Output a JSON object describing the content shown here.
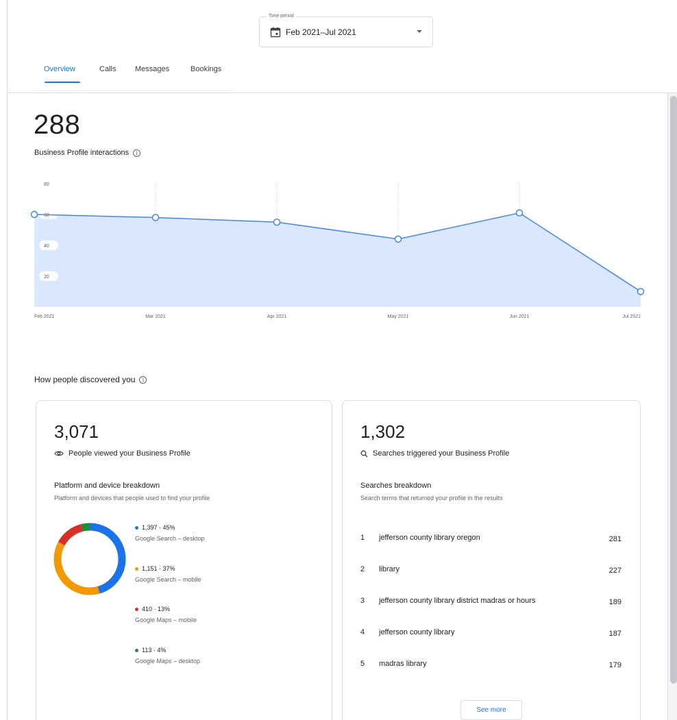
{
  "time_period": {
    "legend": "Time period",
    "value": "Feb 2021–Jul 2021"
  },
  "tabs": [
    {
      "label": "Overview",
      "active": true
    },
    {
      "label": "Calls",
      "active": false
    },
    {
      "label": "Messages",
      "active": false
    },
    {
      "label": "Bookings",
      "active": false
    }
  ],
  "interactions": {
    "total": "288",
    "label": "Business Profile interactions"
  },
  "chart_data": {
    "type": "area",
    "x": [
      "Feb 2021",
      "Mar 2021",
      "Apr 2021",
      "May 2021",
      "Jun 2021",
      "Jul 2021"
    ],
    "values": [
      60,
      58,
      55,
      44,
      61,
      10
    ],
    "yticks": [
      20,
      40,
      60,
      80
    ],
    "ylim": [
      0,
      80
    ],
    "grid": "vertical-dotted",
    "colors": {
      "line": "#4285f4",
      "fill": "#dbe7fd"
    }
  },
  "discovery": {
    "title": "How people discovered you",
    "views": {
      "total": "3,071",
      "label": "People viewed your Business Profile",
      "icon": "eye-icon",
      "breakdown_title": "Platform and device breakdown",
      "breakdown_desc": "Platform and devices that people used to find your profile",
      "segments": [
        {
          "value": "1,397 · 45%",
          "label": "Google Search – desktop",
          "percent": 45,
          "color": "#1a73e8"
        },
        {
          "value": "1,151 · 37%",
          "label": "Google Search – mobile",
          "percent": 37,
          "color": "#f29900"
        },
        {
          "value": "410 · 13%",
          "label": "Google Maps – mobile",
          "percent": 13,
          "color": "#d93025"
        },
        {
          "value": "113 · 4%",
          "label": "Google Maps – desktop",
          "percent": 4,
          "color": "#1e8e3e"
        }
      ]
    },
    "searches": {
      "total": "1,302",
      "label": "Searches triggered your Business Profile",
      "icon": "search-icon",
      "breakdown_title": "Searches breakdown",
      "breakdown_desc": "Search terms that returned your profile in the results",
      "terms": [
        {
          "rank": "1",
          "term": "jefferson county library oregon",
          "count": "281"
        },
        {
          "rank": "2",
          "term": "library",
          "count": "227"
        },
        {
          "rank": "3",
          "term": "jefferson county library district madras or hours",
          "count": "189"
        },
        {
          "rank": "4",
          "term": "jefferson county library",
          "count": "187"
        },
        {
          "rank": "5",
          "term": "madras library",
          "count": "179"
        }
      ],
      "see_more": "See more"
    }
  }
}
